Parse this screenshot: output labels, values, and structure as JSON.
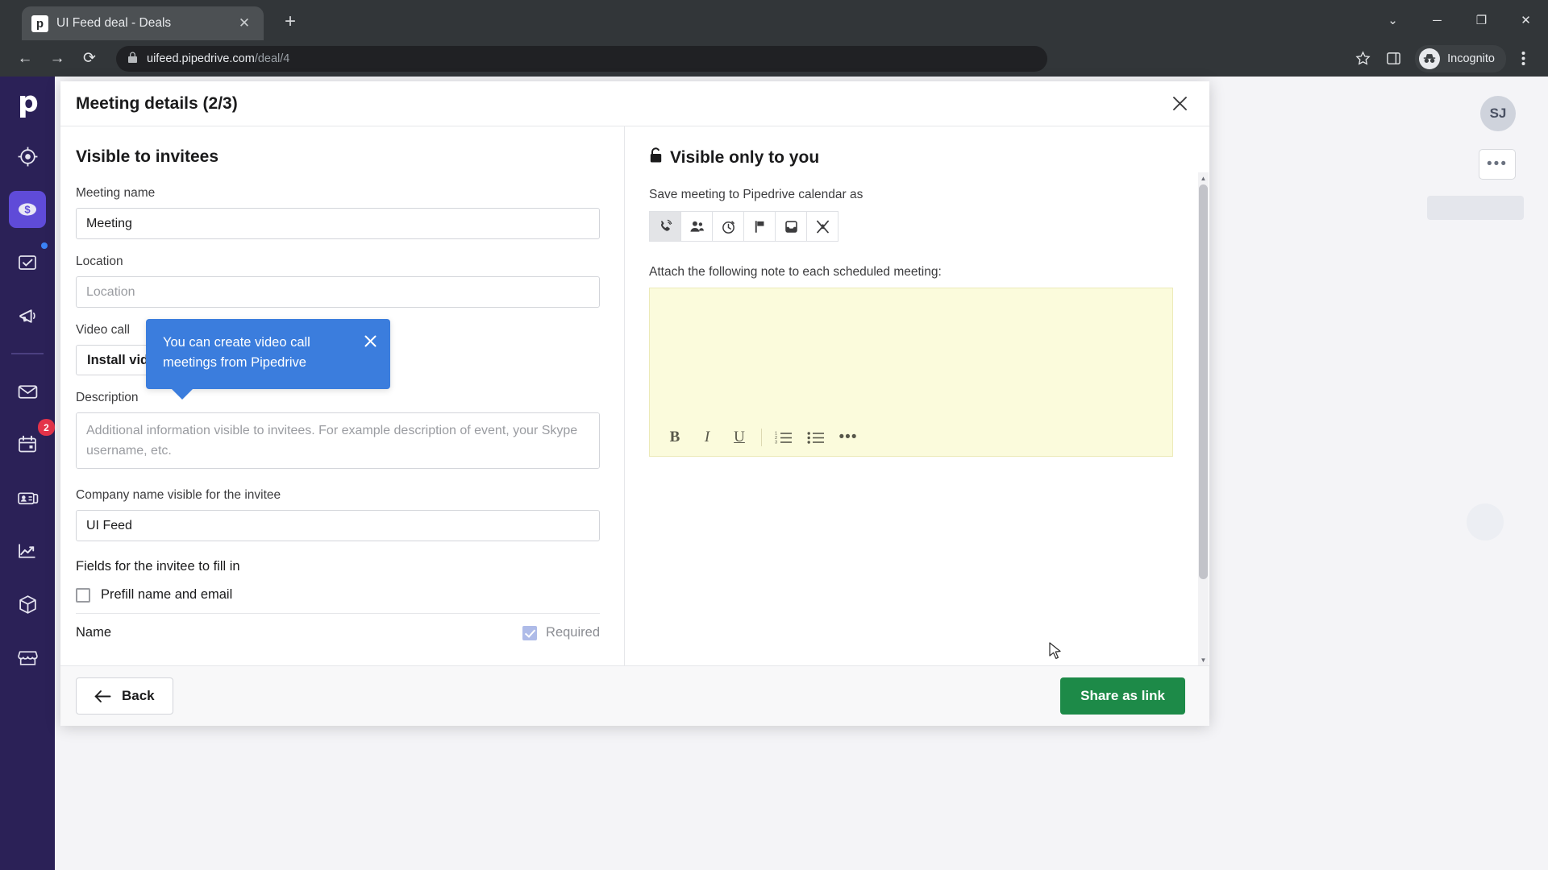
{
  "browser": {
    "tab": {
      "title": "UI Feed deal - Deals",
      "favicon_letter": "p",
      "close_label": "✕"
    },
    "new_tab_label": "+",
    "window_controls": {
      "minimize_all": "⌄",
      "minimize": "─",
      "maximize": "❐",
      "close": "✕"
    },
    "nav": {
      "back": "←",
      "forward": "→",
      "reload": "⟳"
    },
    "address": {
      "lock_icon": "lock-icon",
      "domain": "uifeed.pipedrive.com",
      "path": "/deal/4"
    },
    "bookmark_icon": "star-icon",
    "sidepanel_icon": "side-panel-icon",
    "profile": {
      "label": "Incognito",
      "icon": "incognito-icon"
    },
    "menu_icon": "kebab-menu-icon"
  },
  "sidebar": {
    "logo": "pipedrive-logo",
    "items": [
      {
        "name": "leads-inbox",
        "icon": "target-icon",
        "active": false,
        "dot": false,
        "badge": ""
      },
      {
        "name": "deals",
        "icon": "deal-coin-icon",
        "active": true,
        "dot": false,
        "badge": ""
      },
      {
        "name": "activities",
        "icon": "checkbox-clipboard-icon",
        "active": false,
        "dot": true,
        "badge": ""
      },
      {
        "name": "campaigns",
        "icon": "megaphone-icon",
        "active": false,
        "dot": false,
        "badge": ""
      },
      {
        "name": "mail",
        "icon": "envelope-icon",
        "active": false,
        "dot": false,
        "badge": ""
      },
      {
        "name": "calendar",
        "icon": "calendar-icon",
        "active": false,
        "dot": false,
        "badge": "2"
      },
      {
        "name": "contacts",
        "icon": "contact-card-icon",
        "active": false,
        "dot": false,
        "badge": ""
      },
      {
        "name": "insights",
        "icon": "line-chart-icon",
        "active": false,
        "dot": false,
        "badge": ""
      },
      {
        "name": "products",
        "icon": "box-icon",
        "active": false,
        "dot": false,
        "badge": ""
      },
      {
        "name": "marketplace",
        "icon": "marketplace-icon",
        "active": false,
        "dot": false,
        "badge": ""
      }
    ]
  },
  "background_app": {
    "avatar_initials": "SJ",
    "more_actions": "•••"
  },
  "modal": {
    "title": "Meeting details (2/3)",
    "close_icon": "close-icon",
    "left": {
      "section_title": "Visible to invitees",
      "meeting_name": {
        "label": "Meeting name",
        "value": "Meeting"
      },
      "location": {
        "label": "Location",
        "value": "",
        "placeholder": "Location"
      },
      "video_call": {
        "label": "Video call",
        "button_label": "Install video call integration"
      },
      "description": {
        "label": "Description",
        "value": "",
        "placeholder": "Additional information visible to invitees. For example description of event, your Skype username, etc."
      },
      "company_name": {
        "label": "Company name visible for the invitee",
        "value": "UI Feed"
      },
      "fields_section": {
        "title": "Fields for the invitee to fill in",
        "prefill": {
          "label": "Prefill name and email",
          "checked": false
        },
        "rows": [
          {
            "name": "Name",
            "required_label": "Required",
            "required_checked": true
          }
        ]
      }
    },
    "tooltip": {
      "text": "You can create video call meetings from Pipedrive",
      "close_icon": "close-icon",
      "color": "#3b7ddd"
    },
    "right": {
      "section_title": "Visible only to you",
      "lock_icon": "lock-icon",
      "calendar_as": {
        "label": "Save meeting to Pipedrive calendar as",
        "options": [
          {
            "name": "call",
            "icon": "phone-call-icon",
            "selected": true
          },
          {
            "name": "meeting",
            "icon": "people-icon",
            "selected": false
          },
          {
            "name": "deadline",
            "icon": "stopwatch-icon",
            "selected": false
          },
          {
            "name": "task",
            "icon": "flag-icon",
            "selected": false
          },
          {
            "name": "email",
            "icon": "inbox-tray-icon",
            "selected": false
          },
          {
            "name": "lunch",
            "icon": "cutlery-icon",
            "selected": false
          }
        ]
      },
      "note": {
        "label": "Attach the following note to each scheduled meeting:",
        "value": "",
        "background": "#fbfbdc",
        "toolbar": [
          {
            "name": "bold",
            "glyph": "B"
          },
          {
            "name": "italic",
            "glyph": "I"
          },
          {
            "name": "underline",
            "glyph": "U"
          },
          {
            "name": "ordered-list",
            "glyph": "ordered-list-icon"
          },
          {
            "name": "bulleted-list",
            "glyph": "bulleted-list-icon"
          },
          {
            "name": "more-options",
            "glyph": "•••"
          }
        ]
      }
    },
    "footer": {
      "back_label": "Back",
      "back_icon": "arrow-left-icon",
      "share_label": "Share as link",
      "share_color": "#1d8a48"
    },
    "scrollbar": {
      "up": "▲",
      "down": "▼"
    }
  }
}
